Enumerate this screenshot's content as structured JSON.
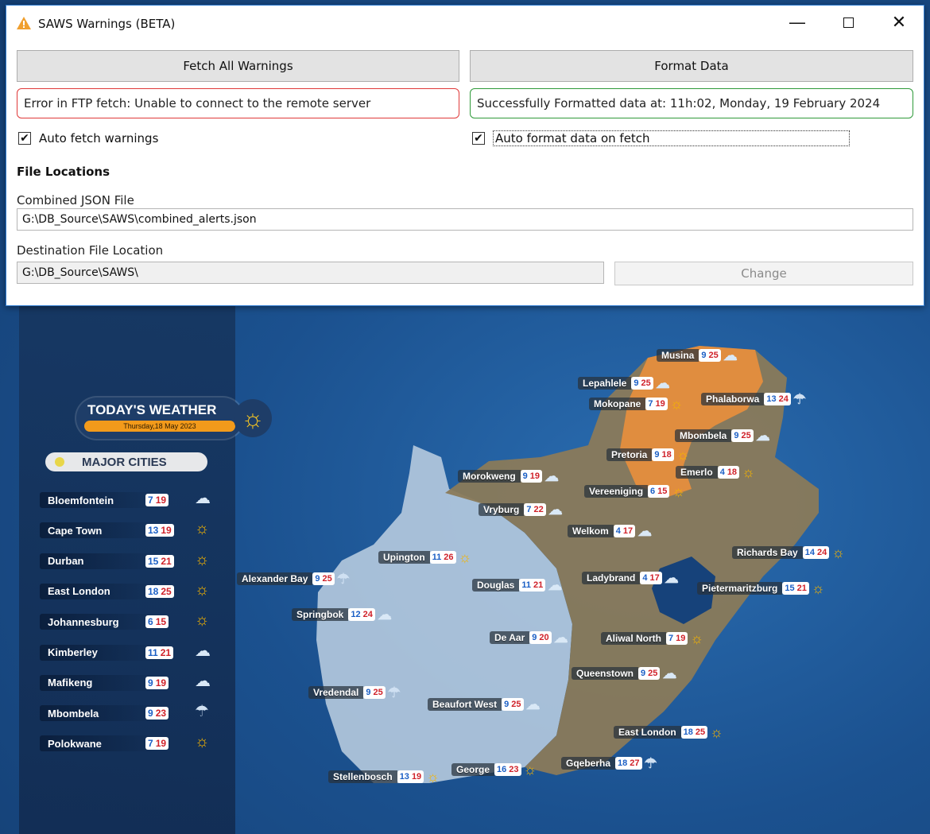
{
  "window": {
    "title": "SAWS Warnings (BETA)",
    "fetch_button": "Fetch All Warnings",
    "format_button": "Format Data",
    "fetch_status": "Error in FTP fetch: Unable to connect to the remote server",
    "format_status": "Successfully Formatted data at: 11h:02, Monday, 19 February 2024",
    "auto_fetch": {
      "label": "Auto fetch warnings",
      "checked": true
    },
    "auto_format": {
      "label": "Auto format data on fetch",
      "checked": true
    },
    "file_locations_heading": "File Locations",
    "combined_json_label": "Combined JSON File",
    "combined_json_value": "G:\\DB_Source\\SAWS\\combined_alerts.json",
    "destination_label": "Destination File Location",
    "destination_value": "G:\\DB_Source\\SAWS\\",
    "change_button": "Change",
    "colors": {
      "error": "#e03a3a",
      "success": "#2f9a3a",
      "accent": "#2e7bd0"
    }
  },
  "background": {
    "today_title": "TODAY'S WEATHER",
    "today_date": "Thursday,18 May 2023",
    "major_cities_heading": "MAJOR CITIES",
    "major_cities": [
      {
        "name": "Bloemfontein",
        "lo": "7",
        "hi": "19",
        "icon": "cloud-icon"
      },
      {
        "name": "Cape Town",
        "lo": "13",
        "hi": "19",
        "icon": "sun-icon"
      },
      {
        "name": "Durban",
        "lo": "15",
        "hi": "21",
        "icon": "sun-icon"
      },
      {
        "name": "East London",
        "lo": "18",
        "hi": "25",
        "icon": "sun-icon"
      },
      {
        "name": "Johannesburg",
        "lo": "6",
        "hi": "15",
        "icon": "sun-icon"
      },
      {
        "name": "Kimberley",
        "lo": "11",
        "hi": "21",
        "icon": "cloud-icon"
      },
      {
        "name": "Mafikeng",
        "lo": "9",
        "hi": "19",
        "icon": "cloud-icon"
      },
      {
        "name": "Mbombela",
        "lo": "9",
        "hi": "23",
        "icon": "rain-icon"
      },
      {
        "name": "Polokwane",
        "lo": "7",
        "hi": "19",
        "icon": "sun-icon"
      }
    ],
    "map_cities": [
      {
        "name": "Musina",
        "lo": "9",
        "hi": "25",
        "icon": "cloud"
      },
      {
        "name": "Lepahlele",
        "lo": "9",
        "hi": "25",
        "icon": "cloud"
      },
      {
        "name": "Mokopane",
        "lo": "7",
        "hi": "19",
        "icon": "sun"
      },
      {
        "name": "Phalaborwa",
        "lo": "13",
        "hi": "24",
        "icon": "rain"
      },
      {
        "name": "Mbombela",
        "lo": "9",
        "hi": "25",
        "icon": "cloud"
      },
      {
        "name": "Pretoria",
        "lo": "9",
        "hi": "18",
        "icon": "sun"
      },
      {
        "name": "Emerlo",
        "lo": "4",
        "hi": "18",
        "icon": "sun"
      },
      {
        "name": "Morokweng",
        "lo": "9",
        "hi": "19",
        "icon": "cloud"
      },
      {
        "name": "Vereeniging",
        "lo": "6",
        "hi": "15",
        "icon": "sun"
      },
      {
        "name": "Vryburg",
        "lo": "7",
        "hi": "22",
        "icon": "cloud"
      },
      {
        "name": "Welkom",
        "lo": "4",
        "hi": "17",
        "icon": "cloud"
      },
      {
        "name": "Upington",
        "lo": "11",
        "hi": "26",
        "icon": "sun"
      },
      {
        "name": "Richards Bay",
        "lo": "14",
        "hi": "24",
        "icon": "sun"
      },
      {
        "name": "Alexander Bay",
        "lo": "9",
        "hi": "25",
        "icon": "rain"
      },
      {
        "name": "Ladybrand",
        "lo": "4",
        "hi": "17",
        "icon": "cloud"
      },
      {
        "name": "Douglas",
        "lo": "11",
        "hi": "21",
        "icon": "cloud"
      },
      {
        "name": "Pietermaritzburg",
        "lo": "15",
        "hi": "21",
        "icon": "sun"
      },
      {
        "name": "Springbok",
        "lo": "12",
        "hi": "24",
        "icon": "cloud"
      },
      {
        "name": "De Aar",
        "lo": "9",
        "hi": "20",
        "icon": "cloud"
      },
      {
        "name": "Aliwal North",
        "lo": "7",
        "hi": "19",
        "icon": "sun"
      },
      {
        "name": "Queenstown",
        "lo": "9",
        "hi": "25",
        "icon": "cloud"
      },
      {
        "name": "Vredendal",
        "lo": "9",
        "hi": "25",
        "icon": "rain"
      },
      {
        "name": "Beaufort West",
        "lo": "9",
        "hi": "25",
        "icon": "cloud"
      },
      {
        "name": "East London",
        "lo": "18",
        "hi": "25",
        "icon": "sun"
      },
      {
        "name": "Gqeberha",
        "lo": "18",
        "hi": "27",
        "icon": "rain"
      },
      {
        "name": "George",
        "lo": "16",
        "hi": "23",
        "icon": "sun"
      },
      {
        "name": "Stellenbosch",
        "lo": "13",
        "hi": "19",
        "icon": "sun"
      }
    ]
  }
}
